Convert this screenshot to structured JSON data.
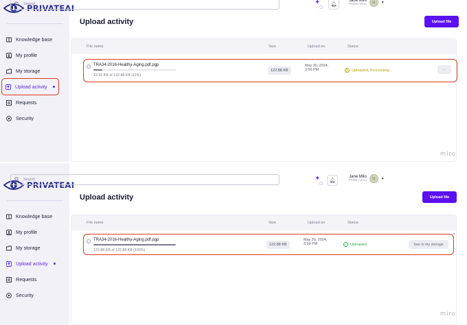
{
  "app": {
    "logo_text": "PRIVATEAI"
  },
  "sidebar": {
    "items": [
      {
        "label": "Knowledge base",
        "icon": "book-icon"
      },
      {
        "label": "My profile",
        "icon": "profile-icon"
      },
      {
        "label": "My storage",
        "icon": "storage-icon"
      },
      {
        "label": "Upload activity",
        "icon": "upload-icon",
        "active": true
      },
      {
        "label": "Requests",
        "icon": "requests-icon"
      },
      {
        "label": "Security",
        "icon": "security-icon"
      }
    ]
  },
  "header": {
    "search_placeholder": "Search",
    "user": {
      "name": "Jane Milo",
      "subtitle": "Profile menu"
    }
  },
  "page": {
    "title": "Upload activity",
    "upload_button": "Upload file",
    "columns": {
      "file": "File name",
      "size": "Size",
      "upload_on": "Upload on",
      "status": "Status"
    }
  },
  "frames": [
    {
      "file_name": "TRA34-2016-Healthy-Aging.pdf.pgp",
      "progress_text": "13.52 KB of 122.88 KB (11%)",
      "progress_fraction": 0.11,
      "size": "122.88 KB",
      "date_line1": "May 30, 2024,",
      "date_line2": "3:59 PM",
      "status": "Uploaded, Processing...",
      "action": "···"
    },
    {
      "file_name": "TRA34-2016-Healthy-Aging.pdf.pgp",
      "progress_text": "122.88 KB of 122.88 KB (100%)",
      "progress_fraction": 1.0,
      "size": "122.88 KB",
      "date_line1": "May 30, 2024,",
      "date_line2": "3:59 PM",
      "status": "Uploaded",
      "action": "See in my storage"
    }
  ],
  "watermark": "miro",
  "colors": {
    "accent": "#5b10f0",
    "highlight": "#d9381e",
    "processing": "#b8a000",
    "success": "#34a853"
  }
}
